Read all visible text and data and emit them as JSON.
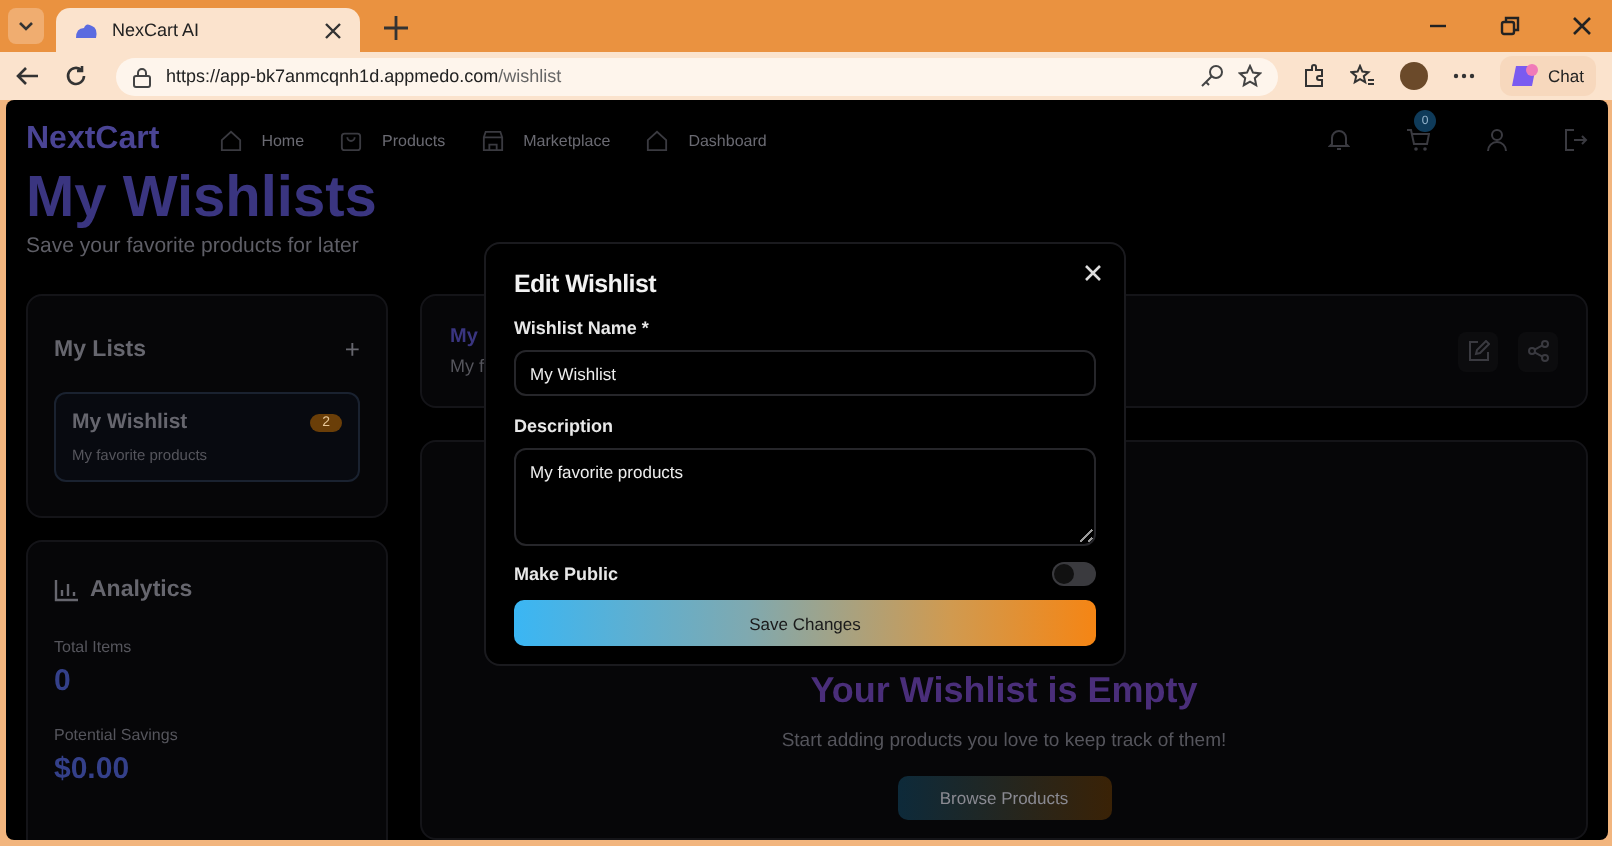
{
  "browser": {
    "tab_title": "NexCart AI",
    "url_host": "https://app-bk7anmcqnh1d.appmedo.com",
    "url_path": "/wishlist",
    "chat_label": "Chat"
  },
  "navbar": {
    "logo": "NextCart",
    "links": [
      {
        "label": "Home"
      },
      {
        "label": "Products"
      },
      {
        "label": "Marketplace"
      },
      {
        "label": "Dashboard"
      }
    ],
    "cart_count": "0"
  },
  "header": {
    "title": "My Wishlists",
    "subtitle": "Save your favorite products for later"
  },
  "lists_panel": {
    "title": "My Lists",
    "add_icon": "+",
    "lists": [
      {
        "name": "My Wishlist",
        "description": "My favorite products",
        "count": "2",
        "selected": true
      }
    ]
  },
  "analytics": {
    "title": "Analytics",
    "stats": [
      {
        "label": "Total Items",
        "value": "0"
      },
      {
        "label": "Potential Savings",
        "value": "$0.00"
      }
    ]
  },
  "detail": {
    "name_visible": "My",
    "description_visible": "My f"
  },
  "empty_state": {
    "title": "Your Wishlist is Empty",
    "text": "Start adding products you love to keep track of them!",
    "button": "Browse Products"
  },
  "modal": {
    "title": "Edit Wishlist",
    "name_label": "Wishlist Name *",
    "name_value": "My Wishlist",
    "description_label": "Description",
    "description_value": "My favorite products",
    "public_label": "Make Public",
    "public_on": false,
    "save_button": "Save Changes"
  }
}
